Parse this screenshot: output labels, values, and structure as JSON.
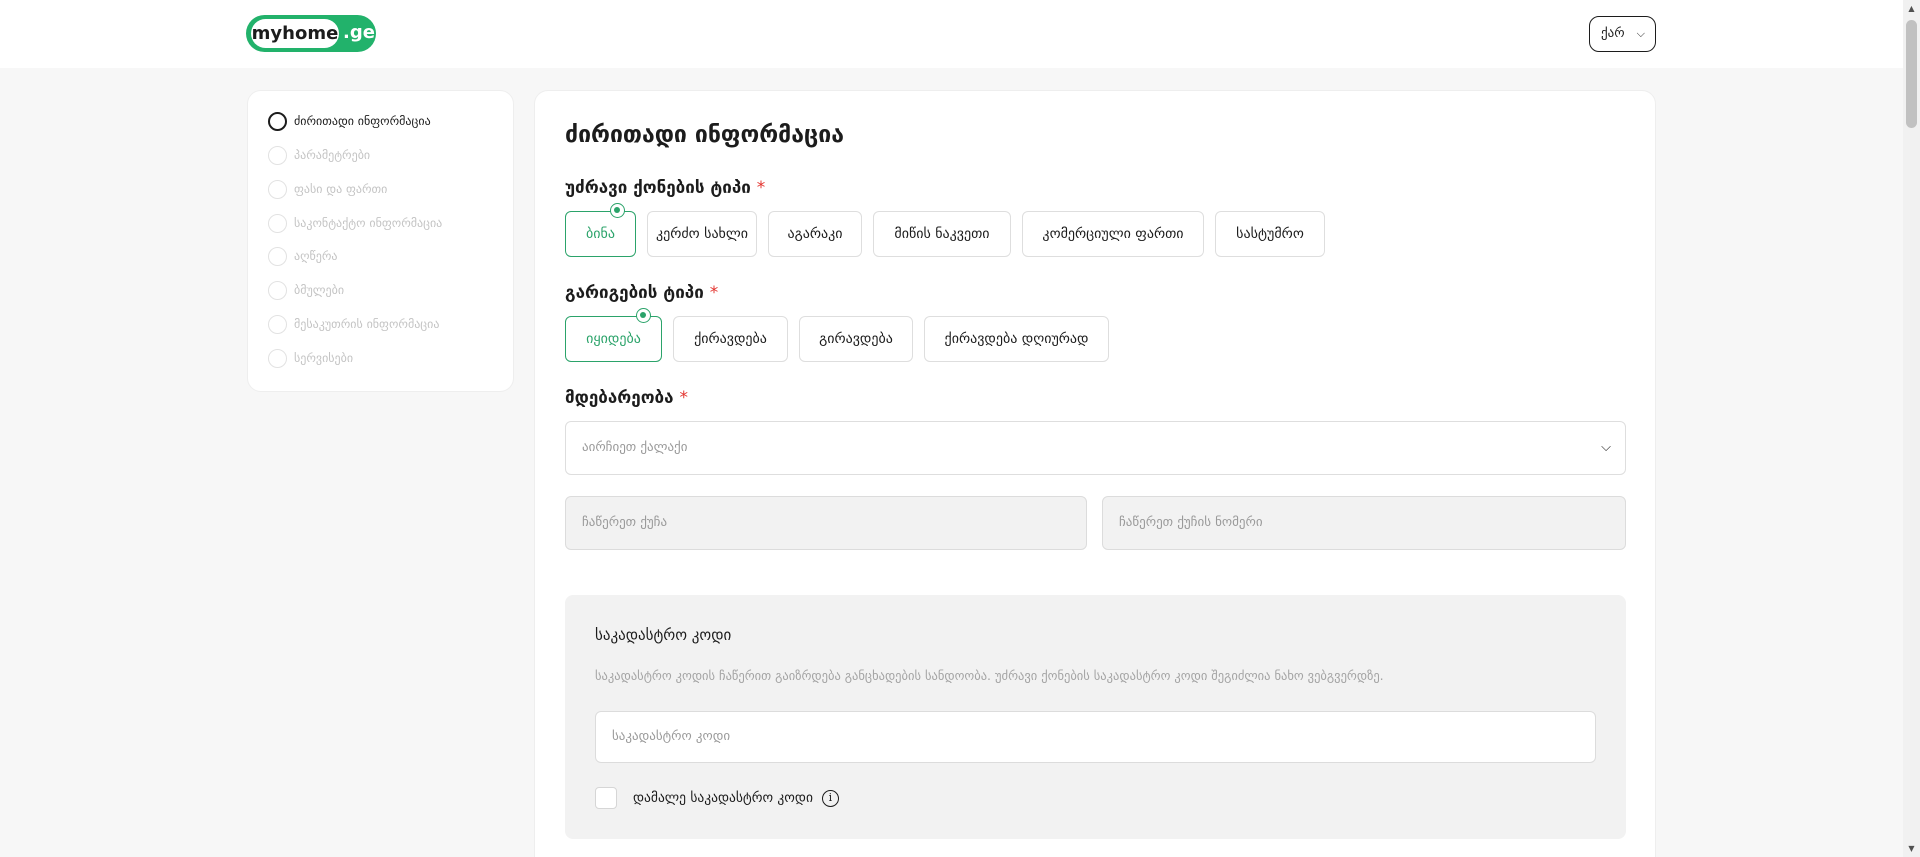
{
  "header": {
    "logo_text": "myhome",
    "logo_tld": ".ge",
    "language": "ქარ",
    "language_icon": "chevron-down-icon"
  },
  "sidebar": {
    "steps": [
      {
        "label": "ძირითადი ინფორმაცია",
        "active": true
      },
      {
        "label": "პარამეტრები",
        "active": false
      },
      {
        "label": "ფასი და ფართი",
        "active": false
      },
      {
        "label": "საკონტაქტო ინფორმაცია",
        "active": false
      },
      {
        "label": "აღწერა",
        "active": false
      },
      {
        "label": "ბმულები",
        "active": false
      },
      {
        "label": "მესაკუთრის ინფორმაცია",
        "active": false
      },
      {
        "label": "სერვისები",
        "active": false
      }
    ]
  },
  "main": {
    "title": "ძირითადი ინფორმაცია",
    "property_type": {
      "label": "უძრავი ქონების ტიპი",
      "required_mark": "*",
      "options": [
        "ბინა",
        "კერძო სახლი",
        "აგარაკი",
        "მიწის ნაკვეთი",
        "კომერციული ფართი",
        "სასტუმრო"
      ],
      "selected": "ბინა"
    },
    "deal_type": {
      "label": "გარიგების ტიპი",
      "required_mark": "*",
      "options": [
        "იყიდება",
        "ქირავდება",
        "გირავდება",
        "ქირავდება დღიურად"
      ],
      "selected": "იყიდება"
    },
    "location": {
      "label": "მდებარეობა",
      "required_mark": "*",
      "city_placeholder": "აირჩიეთ ქალაქი",
      "street_placeholder": "ჩაწერეთ ქუჩა",
      "street_number_placeholder": "ჩაწერეთ ქუჩის ნომერი"
    },
    "cadastral": {
      "title": "საკადასტრო კოდი",
      "description": "საკადასტრო კოდის ჩაწერით გაიზრდება განცხადების სანდოობა. უძრავი ქონების საკადასტრო კოდი შეგიძლია ნახო ვებგვერდზე.",
      "input_placeholder": "საკადასტრო კოდი",
      "hide_label": "დამალე საკადასტრო კოდი",
      "info_glyph": "i"
    }
  },
  "colors": {
    "accent": "#2ba36a",
    "brand": "#22b26b",
    "required": "#e3342f"
  }
}
